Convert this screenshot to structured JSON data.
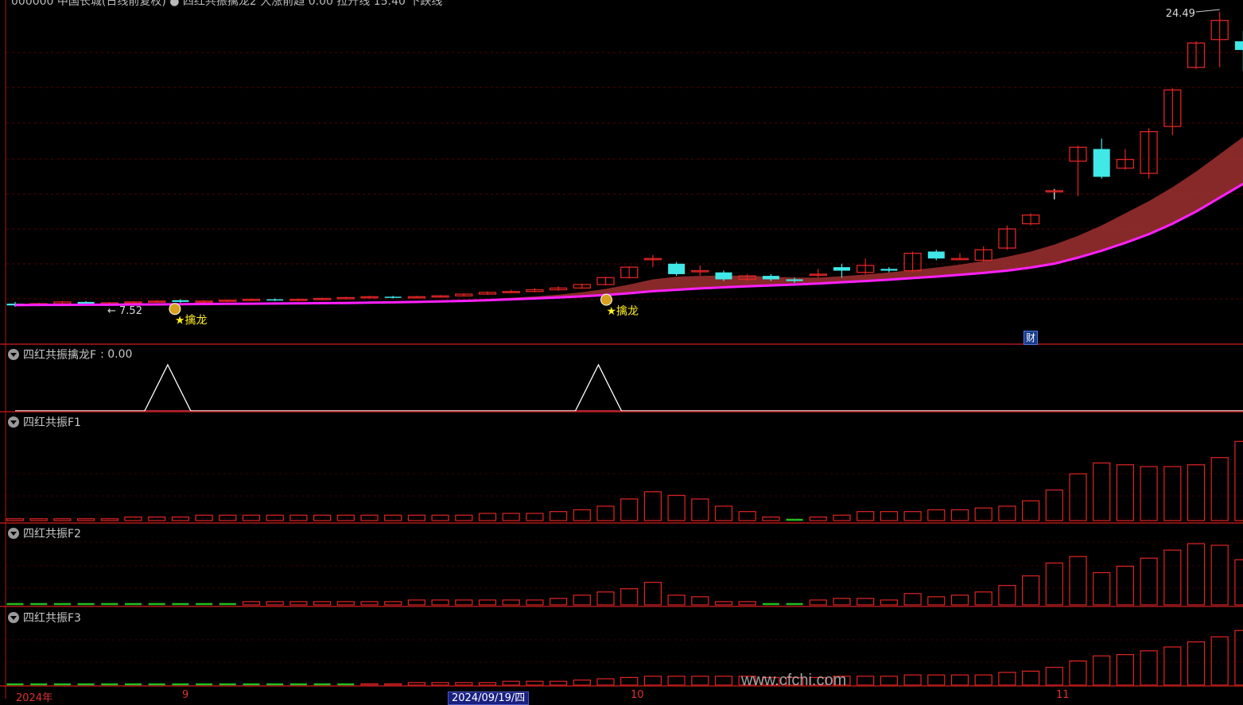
{
  "header": {
    "text": "000000 中国长城(日线前复权) ● 四红共振擒龙2 大涨前趋 0.00 拉升线 15.40 下跌线",
    "legend_colors": {
      "rise": "#ff3030",
      "pull": "#ff40ff",
      "fall": "#30e0e0"
    }
  },
  "panes": {
    "indicator1": {
      "title": "四红共振擒龙F",
      "value": ": 0.00"
    },
    "indicator2": {
      "title": "四红共振F1"
    },
    "indicator3": {
      "title": "四红共振F2"
    },
    "indicator4": {
      "title": "四红共振F3"
    }
  },
  "annotations": {
    "high_label": "24.49",
    "low_label": "7.52",
    "signal_label": "★擒龙",
    "cai_badge": "财"
  },
  "time_axis": {
    "year": "2024年",
    "m9": "9",
    "selected": "2024/09/19/四",
    "m10": "10",
    "m11": "11"
  },
  "watermark": "www.cfchi.com",
  "colors": {
    "up": "#e02424",
    "down": "#40e8e8",
    "ma_line": "#ff20ff",
    "cloud": "#a03030",
    "grid": "#5a0000",
    "separator": "#b01818",
    "neg_bar": "#20c020"
  },
  "chart_data": {
    "type": "candlestick",
    "y_high": 24.49,
    "y_low": 7.52,
    "candles": [
      {
        "o": 7.7,
        "c": 7.6,
        "h": 7.8,
        "l": 7.52
      },
      {
        "o": 7.6,
        "c": 7.7,
        "h": 7.75,
        "l": 7.55
      },
      {
        "o": 7.7,
        "c": 7.8,
        "h": 7.85,
        "l": 7.65
      },
      {
        "o": 7.8,
        "c": 7.7,
        "h": 7.85,
        "l": 7.6
      },
      {
        "o": 7.7,
        "c": 7.75,
        "h": 7.8,
        "l": 7.6
      },
      {
        "o": 7.75,
        "c": 7.8,
        "h": 7.85,
        "l": 7.7
      },
      {
        "o": 7.8,
        "c": 7.85,
        "h": 7.9,
        "l": 7.75
      },
      {
        "o": 7.9,
        "c": 7.8,
        "h": 7.95,
        "l": 7.75
      },
      {
        "o": 7.8,
        "c": 7.85,
        "h": 7.9,
        "l": 7.75
      },
      {
        "o": 7.85,
        "c": 7.9,
        "h": 7.95,
        "l": 7.8
      },
      {
        "o": 7.9,
        "c": 7.95,
        "h": 8.0,
        "l": 7.85
      },
      {
        "o": 7.95,
        "c": 7.9,
        "h": 8.0,
        "l": 7.85
      },
      {
        "o": 7.9,
        "c": 7.95,
        "h": 8.0,
        "l": 7.85
      },
      {
        "o": 7.95,
        "c": 8.0,
        "h": 8.05,
        "l": 7.9
      },
      {
        "o": 8.0,
        "c": 8.05,
        "h": 8.1,
        "l": 7.95
      },
      {
        "o": 8.05,
        "c": 8.1,
        "h": 8.15,
        "l": 8.0
      },
      {
        "o": 8.1,
        "c": 8.05,
        "h": 8.15,
        "l": 8.0
      },
      {
        "o": 8.05,
        "c": 8.1,
        "h": 8.15,
        "l": 8.0
      },
      {
        "o": 8.1,
        "c": 8.15,
        "h": 8.2,
        "l": 8.05
      },
      {
        "o": 8.15,
        "c": 8.25,
        "h": 8.3,
        "l": 8.1
      },
      {
        "o": 8.25,
        "c": 8.35,
        "h": 8.4,
        "l": 8.2
      },
      {
        "o": 8.35,
        "c": 8.4,
        "h": 8.5,
        "l": 8.3
      },
      {
        "o": 8.4,
        "c": 8.5,
        "h": 8.6,
        "l": 8.35
      },
      {
        "o": 8.5,
        "c": 8.6,
        "h": 8.7,
        "l": 8.45
      },
      {
        "o": 8.6,
        "c": 8.8,
        "h": 8.85,
        "l": 8.55
      },
      {
        "o": 8.8,
        "c": 9.2,
        "h": 9.25,
        "l": 8.75
      },
      {
        "o": 9.2,
        "c": 9.8,
        "h": 9.85,
        "l": 9.15
      },
      {
        "o": 10.3,
        "c": 10.3,
        "h": 10.5,
        "l": 9.8
      },
      {
        "o": 10.0,
        "c": 9.4,
        "h": 10.1,
        "l": 9.3
      },
      {
        "o": 9.6,
        "c": 9.6,
        "h": 9.9,
        "l": 9.3
      },
      {
        "o": 9.5,
        "c": 9.1,
        "h": 9.6,
        "l": 9.0
      },
      {
        "o": 9.1,
        "c": 9.3,
        "h": 9.4,
        "l": 9.0
      },
      {
        "o": 9.3,
        "c": 9.1,
        "h": 9.4,
        "l": 9.0
      },
      {
        "o": 9.1,
        "c": 9.0,
        "h": 9.2,
        "l": 8.9
      },
      {
        "o": 9.4,
        "c": 9.4,
        "h": 9.7,
        "l": 9.2
      },
      {
        "o": 9.8,
        "c": 9.6,
        "h": 10.0,
        "l": 9.2
      },
      {
        "o": 9.5,
        "c": 9.9,
        "h": 10.3,
        "l": 9.4
      },
      {
        "o": 9.7,
        "c": 9.6,
        "h": 9.8,
        "l": 9.5
      },
      {
        "o": 9.6,
        "c": 10.6,
        "h": 10.7,
        "l": 9.5
      },
      {
        "o": 10.7,
        "c": 10.3,
        "h": 10.8,
        "l": 10.2
      },
      {
        "o": 10.3,
        "c": 10.3,
        "h": 10.6,
        "l": 10.2
      },
      {
        "o": 10.2,
        "c": 10.8,
        "h": 11.0,
        "l": 10.1
      },
      {
        "o": 10.9,
        "c": 12.0,
        "h": 12.2,
        "l": 10.8
      },
      {
        "o": 12.3,
        "c": 12.8,
        "h": 12.9,
        "l": 12.2
      },
      {
        "o": 14.2,
        "c": 14.2,
        "h": 14.3,
        "l": 13.7
      },
      {
        "o": 15.9,
        "c": 16.7,
        "h": 16.8,
        "l": 13.9
      },
      {
        "o": 16.6,
        "c": 15.0,
        "h": 17.2,
        "l": 14.9
      },
      {
        "o": 15.5,
        "c": 16.0,
        "h": 16.6,
        "l": 15.4
      },
      {
        "o": 15.2,
        "c": 17.6,
        "h": 17.8,
        "l": 14.9
      },
      {
        "o": 17.9,
        "c": 20.0,
        "h": 20.1,
        "l": 17.4
      },
      {
        "o": 21.3,
        "c": 22.7,
        "h": 22.8,
        "l": 21.2
      },
      {
        "o": 22.9,
        "c": 24.0,
        "h": 24.49,
        "l": 21.3
      },
      {
        "o": 22.8,
        "c": 22.3,
        "h": 23.4,
        "l": 21.1
      },
      {
        "o": 22.7,
        "c": 22.3,
        "h": 22.8,
        "l": 22.1
      }
    ],
    "ma_line": [
      7.62,
      7.63,
      7.63,
      7.64,
      7.64,
      7.65,
      7.66,
      7.67,
      7.68,
      7.69,
      7.7,
      7.71,
      7.72,
      7.73,
      7.74,
      7.76,
      7.78,
      7.8,
      7.83,
      7.86,
      7.9,
      7.95,
      8.0,
      8.06,
      8.12,
      8.2,
      8.3,
      8.42,
      8.5,
      8.58,
      8.64,
      8.7,
      8.75,
      8.8,
      8.86,
      8.93,
      9.0,
      9.08,
      9.17,
      9.26,
      9.36,
      9.47,
      9.6,
      9.78,
      10.0,
      10.35,
      10.75,
      11.2,
      11.7,
      12.3,
      13.0,
      13.8,
      14.6,
      15.3
    ],
    "cloud_top": [
      7.7,
      7.7,
      7.7,
      7.7,
      7.7,
      7.7,
      7.7,
      7.72,
      7.73,
      7.74,
      7.75,
      7.76,
      7.77,
      7.78,
      7.8,
      7.82,
      7.84,
      7.86,
      7.89,
      7.93,
      7.98,
      8.04,
      8.12,
      8.22,
      8.36,
      8.55,
      8.8,
      9.1,
      9.25,
      9.3,
      9.32,
      9.3,
      9.25,
      9.2,
      9.2,
      9.28,
      9.38,
      9.5,
      9.63,
      9.78,
      9.95,
      10.15,
      10.4,
      10.7,
      11.1,
      11.6,
      12.2,
      12.9,
      13.6,
      14.4,
      15.3,
      16.3,
      17.3,
      17.9
    ],
    "signal_bars": [
      7,
      25
    ],
    "f1": [
      1,
      1,
      1,
      1,
      1,
      2,
      2,
      2,
      3,
      3,
      3,
      3,
      3,
      3,
      3,
      3,
      3,
      3,
      3,
      3,
      4,
      4,
      4,
      5,
      6,
      8,
      12,
      16,
      14,
      12,
      8,
      5,
      2,
      -1,
      2,
      3,
      5,
      5,
      5,
      6,
      6,
      7,
      8,
      11,
      17,
      26,
      32,
      31,
      30,
      30,
      31,
      35,
      44,
      49,
      47,
      43
    ],
    "f2": [
      -2,
      -2,
      -2,
      -2,
      -2,
      -2,
      -2,
      -2,
      -2,
      -2,
      2,
      2,
      2,
      2,
      2,
      2,
      2,
      3,
      3,
      3,
      3,
      3,
      3,
      4,
      6,
      8,
      10,
      14,
      6,
      5,
      2,
      2,
      -1,
      -1,
      3,
      4,
      4,
      3,
      7,
      5,
      6,
      8,
      12,
      18,
      26,
      30,
      20,
      24,
      29,
      34,
      38,
      37,
      28,
      27
    ],
    "f3": [
      -2,
      -2,
      -2,
      -2,
      -2,
      -2,
      -2,
      -2,
      -2,
      -2,
      -2,
      -2,
      -2,
      -2,
      -1,
      1,
      1,
      2,
      2,
      2,
      2,
      3,
      3,
      3,
      4,
      5,
      6,
      7,
      7,
      7,
      7,
      7,
      6,
      6,
      6,
      7,
      7,
      7,
      8,
      8,
      8,
      8,
      10,
      11,
      14,
      19,
      23,
      24,
      27,
      30,
      34,
      38,
      43,
      45
    ]
  }
}
